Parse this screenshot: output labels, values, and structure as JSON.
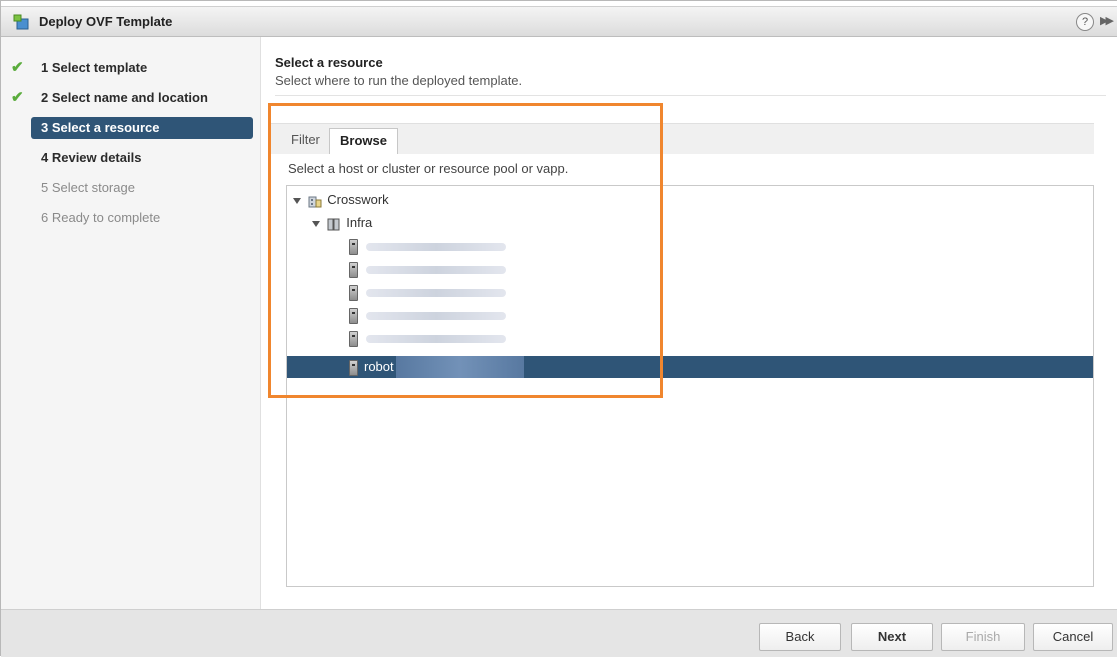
{
  "window": {
    "title": "Deploy OVF Template",
    "help_icon": "help-icon",
    "expand_icon": "expand-icon"
  },
  "steps": [
    {
      "label": "1  Select template",
      "state": "done"
    },
    {
      "label": "2  Select name and location",
      "state": "done"
    },
    {
      "label": "3  Select a resource",
      "state": "active"
    },
    {
      "label": "4  Review details",
      "state": "next"
    },
    {
      "label": "5  Select storage",
      "state": "disabled"
    },
    {
      "label": "6  Ready to complete",
      "state": "disabled"
    }
  ],
  "main": {
    "heading": "Select a resource",
    "subheading": "Select where to run the deployed template.",
    "tabs": [
      {
        "label": "Filter"
      },
      {
        "label": "Browse"
      }
    ],
    "instructions": "Select a host or cluster or resource pool or vapp.",
    "tree": {
      "root": "Crosswork",
      "cluster": "Infra",
      "selected_host": "robot"
    }
  },
  "footer": {
    "back": "Back",
    "next": "Next",
    "finish": "Finish",
    "cancel": "Cancel"
  },
  "colors": {
    "accent": "#2f5577",
    "highlight": "#f0862e",
    "check": "#5aac3c"
  }
}
